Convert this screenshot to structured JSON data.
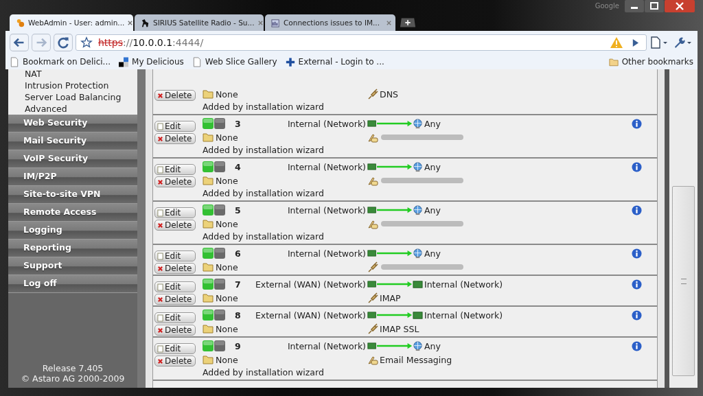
{
  "browser": {
    "corner_label": "Google",
    "tabs": [
      {
        "label": "WebAdmin - User: admin...",
        "selected": true
      },
      {
        "label": "SIRIUS Satellite Radio - Su...",
        "selected": false
      },
      {
        "label": "Connections issues to IM...",
        "selected": false
      }
    ],
    "url": [
      {
        "kind": "scheme",
        "text": "https"
      },
      {
        "kind": "dim",
        "text": "://"
      },
      {
        "kind": "host",
        "text": "10.0.0.1"
      },
      {
        "kind": "dim",
        "text": ":4444/"
      }
    ],
    "forward_disabled": true,
    "bookmarks": [
      "Bookmark on Delici...",
      "My Delicious",
      "Web Slice Gallery",
      "External - Login to ..."
    ],
    "other_bookmarks": "Other bookmarks"
  },
  "sidebar": {
    "sub_items": [
      "NAT",
      "Intrusion Protection",
      "Server Load Balancing",
      "Advanced"
    ],
    "items": [
      "Web Security",
      "Mail Security",
      "VoIP Security",
      "IM/P2P",
      "Site-to-site VPN",
      "Remote Access",
      "Logging",
      "Reporting",
      "Support",
      "Log off"
    ],
    "release": "Release 7.405",
    "copyright": "© Astaro AG 2000-2009"
  },
  "rules": [
    {
      "delete": "Delete",
      "group": "None",
      "service": {
        "kind": "plug",
        "label": "DNS",
        "hidden": false
      },
      "comment": "Added by installation wizard"
    },
    {
      "edit": "Edit",
      "delete": "Delete",
      "on": true,
      "number": "3",
      "source": "Internal (Network)",
      "destination": {
        "kind": "globe",
        "label": "Any"
      },
      "group": "None",
      "service": {
        "kind": "group",
        "hidden": true
      },
      "comment": "Added by installation wizard"
    },
    {
      "edit": "Edit",
      "delete": "Delete",
      "on": true,
      "number": "4",
      "source": "Internal (Network)",
      "destination": {
        "kind": "globe",
        "label": "Any"
      },
      "group": "None",
      "service": {
        "kind": "group",
        "hidden": true
      },
      "comment": "Added by installation wizard"
    },
    {
      "edit": "Edit",
      "delete": "Delete",
      "on": true,
      "number": "5",
      "source": "Internal (Network)",
      "destination": {
        "kind": "globe",
        "label": "Any"
      },
      "group": "None",
      "service": {
        "kind": "group",
        "hidden": true
      },
      "comment": "Added by installation wizard"
    },
    {
      "edit": "Edit",
      "delete": "Delete",
      "on": true,
      "number": "6",
      "source": "Internal (Network)",
      "destination": {
        "kind": "globe",
        "label": "Any"
      },
      "group": "None",
      "service": {
        "kind": "plug",
        "hidden": true
      }
    },
    {
      "edit": "Edit",
      "delete": "Delete",
      "on": true,
      "number": "7",
      "source": "External (WAN) (Network)",
      "destination": {
        "kind": "network",
        "label": "Internal (Network)"
      },
      "group": "None",
      "service": {
        "kind": "plug",
        "label": "IMAP",
        "hidden": false
      }
    },
    {
      "edit": "Edit",
      "delete": "Delete",
      "on": true,
      "number": "8",
      "source": "External (WAN) (Network)",
      "destination": {
        "kind": "network",
        "label": "Internal (Network)"
      },
      "group": "None",
      "service": {
        "kind": "plug",
        "label": "IMAP SSL",
        "hidden": false
      }
    },
    {
      "edit": "Edit",
      "delete": "Delete",
      "on": true,
      "number": "9",
      "source": "Internal (Network)",
      "destination": {
        "kind": "globe",
        "label": "Any"
      },
      "group": "None",
      "service": {
        "kind": "group",
        "label": "Email Messaging",
        "hidden": false
      },
      "comment": "Added by installation wizard"
    }
  ]
}
